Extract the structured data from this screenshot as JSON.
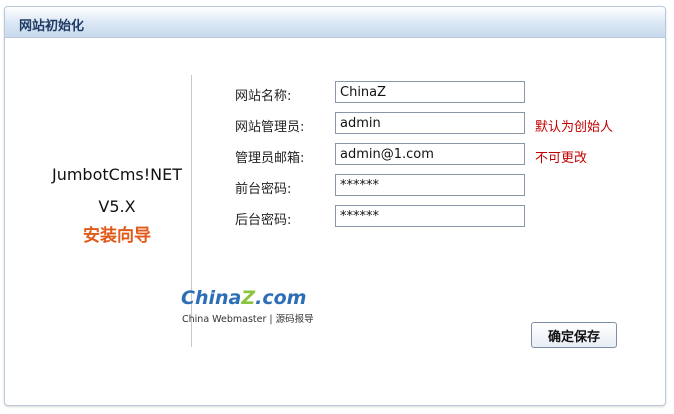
{
  "window": {
    "title": "网站初始化"
  },
  "brand": {
    "name": "JumbotCms!NET",
    "version": "V5.X",
    "guide": "安装向导"
  },
  "form": {
    "site_name_label": "网站名称:",
    "site_name_value": "ChinaZ",
    "admin_label": "网站管理员:",
    "admin_value": "admin",
    "admin_hint": "默认为创始人",
    "email_label": "管理员邮箱:",
    "email_value": "admin@1.com",
    "email_hint": "不可更改",
    "front_pwd_label": "前台密码:",
    "front_pwd_value": "******",
    "back_pwd_label": "后台密码:",
    "back_pwd_value": "******"
  },
  "watermark": {
    "logo_main": "China",
    "logo_z": "Z",
    "logo_tail": ".com",
    "logo_sub": "China Webmaster | 源码报导"
  },
  "actions": {
    "save_label": "确定保存"
  }
}
